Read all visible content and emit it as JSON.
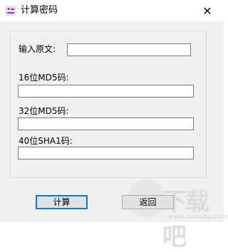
{
  "window": {
    "title": "计算密码",
    "icon": "app-logo-icon",
    "close_glyph": "✕"
  },
  "form": {
    "source_label": "输入原文:",
    "source_value": "",
    "md5_16_label": "16位MD5码:",
    "md5_16_value": "",
    "md5_32_label": "32位MD5码:",
    "md5_32_value": "",
    "sha1_40_label": "40位SHA1码:",
    "sha1_40_value": ""
  },
  "buttons": {
    "compute_label": "计算",
    "back_label": "返回"
  },
  "watermark": {
    "text": "下载吧",
    "url": "www.xiazaiba.com"
  },
  "colors": {
    "client_bg": "#f0f0f0",
    "accent": "#0078d7"
  }
}
